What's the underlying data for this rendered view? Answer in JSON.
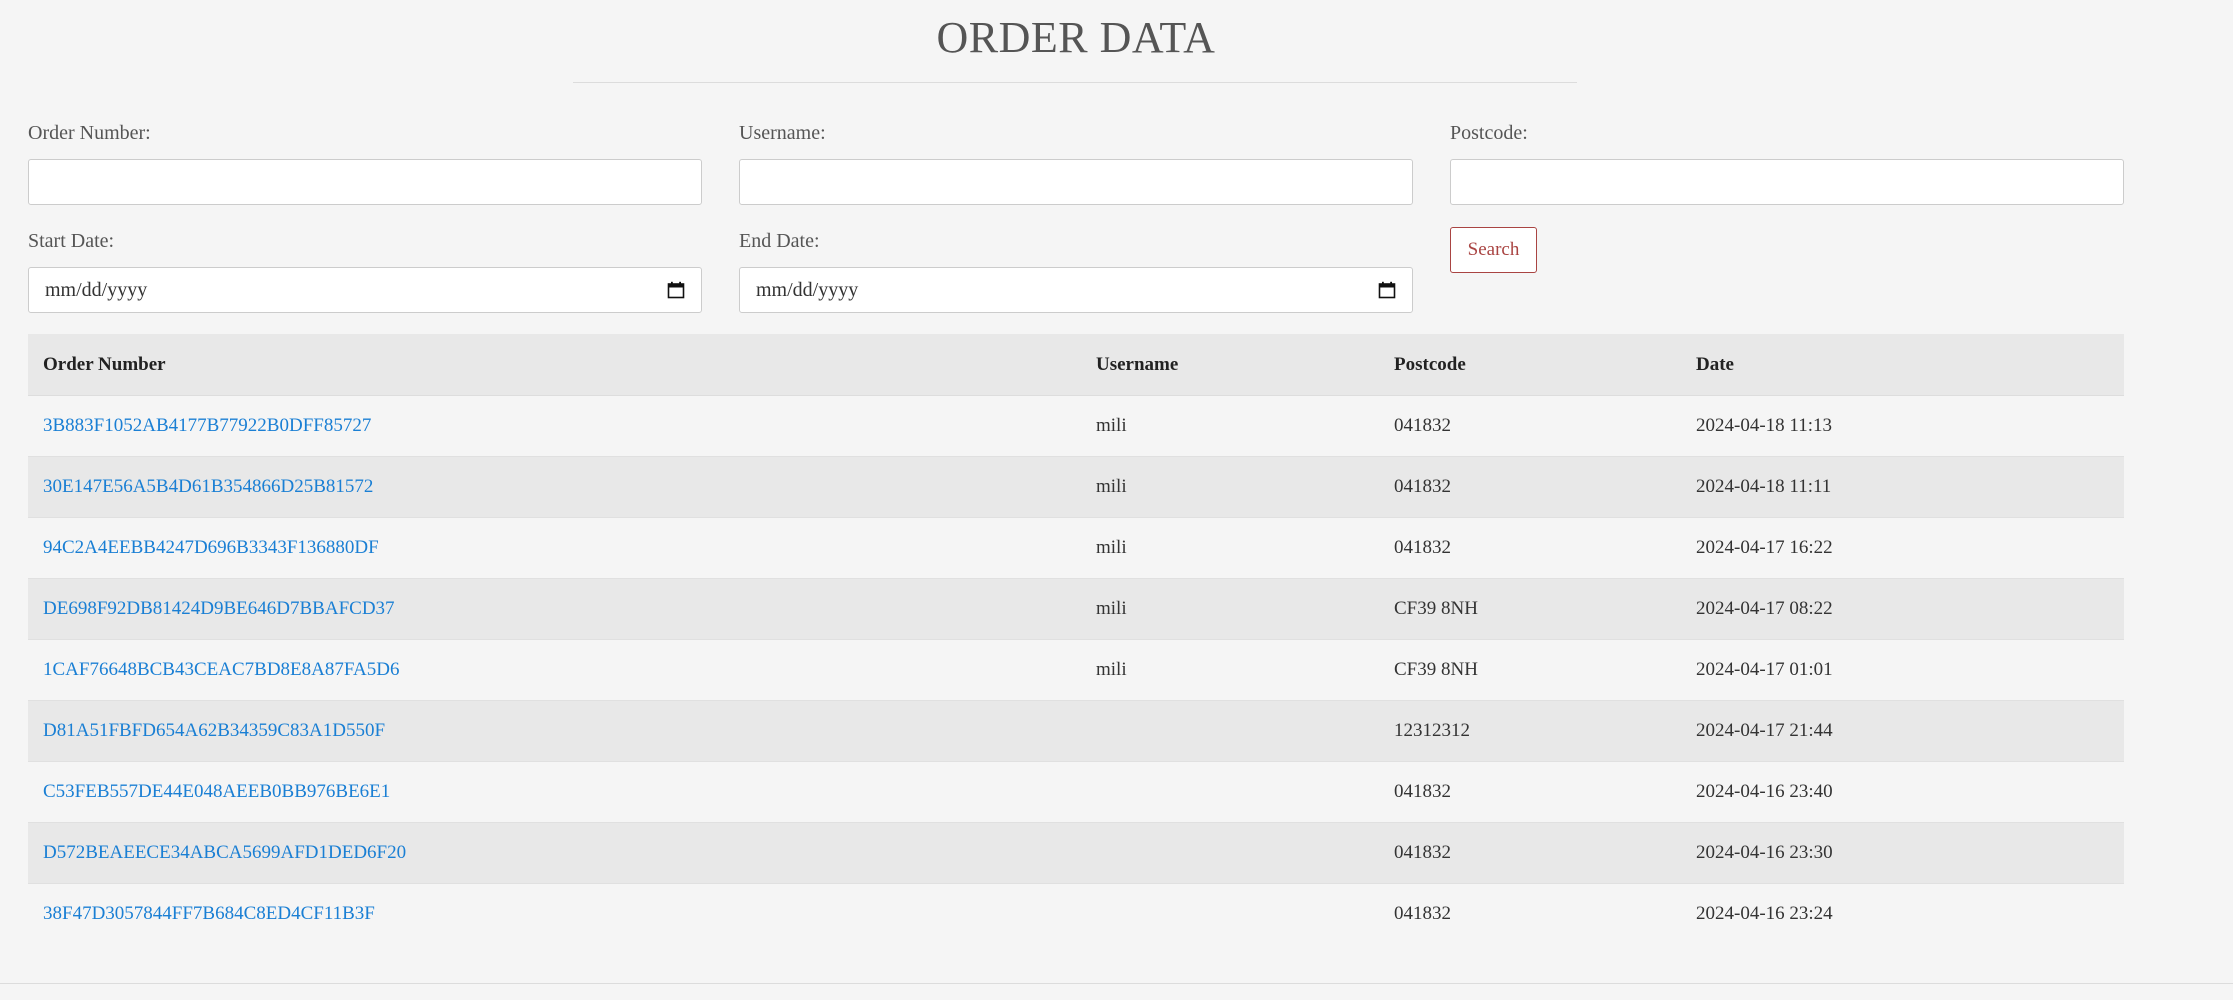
{
  "page": {
    "title": "ORDER DATA"
  },
  "filters": {
    "order_number": {
      "label": "Order Number:",
      "value": ""
    },
    "username": {
      "label": "Username:",
      "value": ""
    },
    "postcode": {
      "label": "Postcode:",
      "value": ""
    },
    "start_date": {
      "label": "Start Date:",
      "placeholder": "mm/dd/yyyy"
    },
    "end_date": {
      "label": "End Date:",
      "placeholder": "mm/dd/yyyy"
    },
    "search_label": "Search"
  },
  "table": {
    "headers": {
      "order_number": "Order Number",
      "username": "Username",
      "postcode": "Postcode",
      "date": "Date"
    },
    "rows": [
      {
        "order_number": "3B883F1052AB4177B77922B0DFF85727",
        "username": "mili",
        "postcode": "041832",
        "date": "2024-04-18 11:13"
      },
      {
        "order_number": "30E147E56A5B4D61B354866D25B81572",
        "username": "mili",
        "postcode": "041832",
        "date": "2024-04-18 11:11"
      },
      {
        "order_number": "94C2A4EEBB4247D696B3343F136880DF",
        "username": "mili",
        "postcode": "041832",
        "date": "2024-04-17 16:22"
      },
      {
        "order_number": "DE698F92DB81424D9BE646D7BBAFCD37",
        "username": "mili",
        "postcode": "CF39 8NH",
        "date": "2024-04-17 08:22"
      },
      {
        "order_number": "1CAF76648BCB43CEAC7BD8E8A87FA5D6",
        "username": "mili",
        "postcode": "CF39 8NH",
        "date": "2024-04-17 01:01"
      },
      {
        "order_number": "D81A51FBFD654A62B34359C83A1D550F",
        "username": "",
        "postcode": "12312312",
        "date": "2024-04-17 21:44"
      },
      {
        "order_number": "C53FEB557DE44E048AEEB0BB976BE6E1",
        "username": "",
        "postcode": "041832",
        "date": "2024-04-16 23:40"
      },
      {
        "order_number": "D572BEAEECE34ABCA5699AFD1DED6F20",
        "username": "",
        "postcode": "041832",
        "date": "2024-04-16 23:30"
      },
      {
        "order_number": "38F47D3057844FF7B684C8ED4CF11B3F",
        "username": "",
        "postcode": "041832",
        "date": "2024-04-16 23:24"
      }
    ]
  },
  "colors": {
    "link": "#1a7fd4",
    "search_button": "#a94442",
    "background": "#f5f5f5",
    "stripe": "#e8e8e8"
  }
}
